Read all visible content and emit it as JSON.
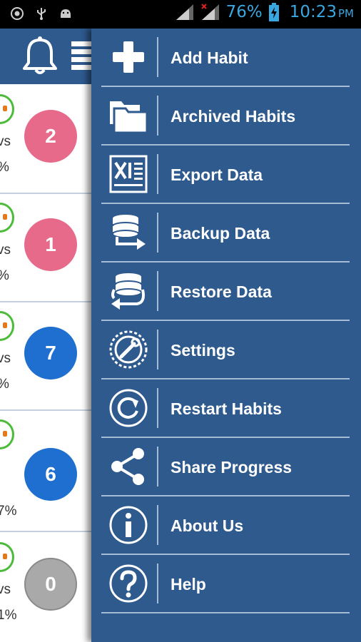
{
  "status_bar": {
    "battery_percent": "76%",
    "time": "10:23",
    "ampm": "PM",
    "icons": [
      "notification-icon",
      "usb-icon",
      "android-icon"
    ]
  },
  "header": {
    "icons": [
      "bell-icon",
      "list-icon"
    ]
  },
  "habits": [
    {
      "count": "2",
      "color": "#e86a8a",
      "text1": "vs",
      "text2": "%"
    },
    {
      "count": "1",
      "color": "#e86a8a",
      "text1": "vs",
      "text2": "%"
    },
    {
      "count": "7",
      "color": "#1e6fd0",
      "text1": "vs",
      "text2": "%"
    },
    {
      "count": "6",
      "color": "#1e6fd0",
      "text1": "",
      "text2": "7%"
    },
    {
      "count": "0",
      "color": "#a9a9a9",
      "text1": "vs",
      "text2": "1%"
    }
  ],
  "menu": {
    "items": [
      {
        "label": "Add Habit",
        "icon": "plus-icon"
      },
      {
        "label": "Archived Habits",
        "icon": "folder-icon"
      },
      {
        "label": "Export Data",
        "icon": "excel-icon"
      },
      {
        "label": "Backup Data",
        "icon": "database-backup-icon"
      },
      {
        "label": "Restore Data",
        "icon": "database-restore-icon"
      },
      {
        "label": "Settings",
        "icon": "settings-icon"
      },
      {
        "label": "Restart Habits",
        "icon": "restart-icon"
      },
      {
        "label": "Share Progress",
        "icon": "share-icon"
      },
      {
        "label": "About Us",
        "icon": "info-icon"
      },
      {
        "label": "Help",
        "icon": "help-icon"
      }
    ]
  },
  "colors": {
    "drawer": "#2e5a8e",
    "status_text": "#39a8e0"
  }
}
